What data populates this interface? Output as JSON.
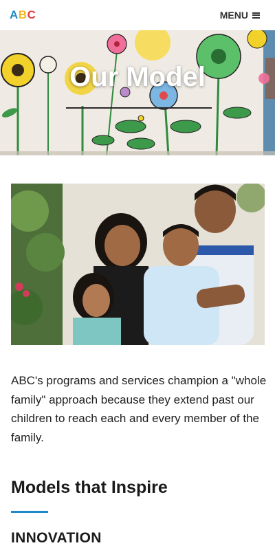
{
  "header": {
    "logo_letters": [
      "A",
      "B",
      "C"
    ],
    "menu_label": "MENU"
  },
  "hero": {
    "title": "Our Model"
  },
  "main": {
    "intro": "ABC's programs and services champion a \"whole family\" approach because they extend past our children to reach each and every member of the family.",
    "section_heading": "Models that Inspire",
    "sub_heading": "INNOVATION"
  },
  "colors": {
    "logo_a": "#1b8ac7",
    "logo_b": "#f2b51d",
    "logo_c": "#e03d3a",
    "accent": "#1b8ac7"
  },
  "icons": {
    "menu": "hamburger-icon"
  }
}
